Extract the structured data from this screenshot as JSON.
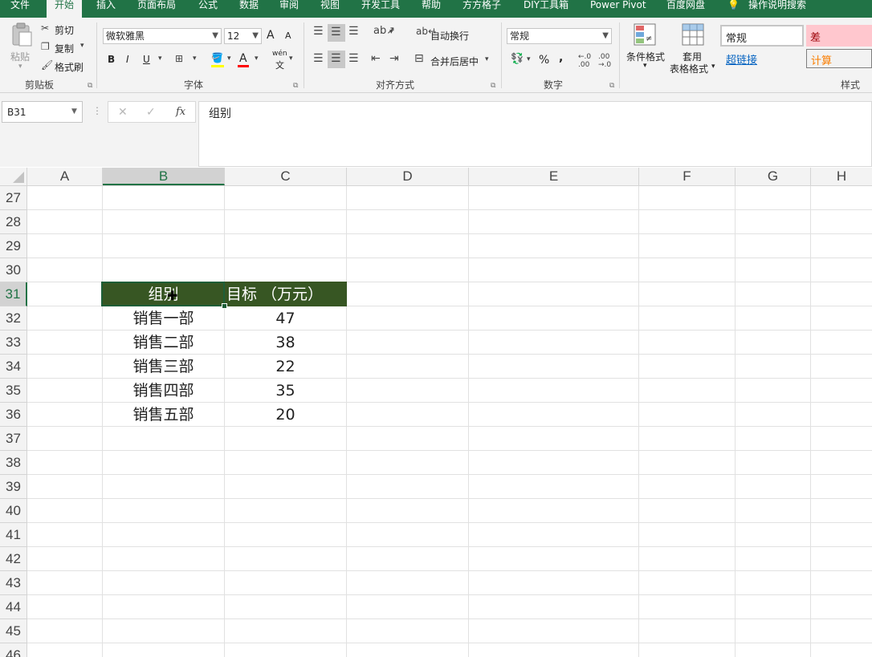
{
  "menu": {
    "tabs": [
      "文件",
      "开始",
      "插入",
      "页面布局",
      "公式",
      "数据",
      "审阅",
      "视图",
      "开发工具",
      "帮助",
      "方方格子",
      "DIY工具箱",
      "Power Pivot",
      "百度网盘"
    ],
    "tell_me": "操作说明搜索"
  },
  "ribbon": {
    "clipboard": {
      "paste": "粘贴",
      "cut": "剪切",
      "copy": "复制",
      "format_painter": "格式刷",
      "label": "剪贴板"
    },
    "font": {
      "name": "微软雅黑",
      "size": "12",
      "label": "字体",
      "bold": "B",
      "italic": "I",
      "underline": "U",
      "grow": "A",
      "shrink": "A",
      "phonetic": "wén",
      "phonetic_char": "文"
    },
    "alignment": {
      "wrap": "自动换行",
      "merge": "合并后居中",
      "label": "对齐方式"
    },
    "number": {
      "format": "常规",
      "label": "数字",
      "percent": "%",
      "comma": ","
    },
    "styles": {
      "cond_format": "条件格式",
      "table_format_1": "套用",
      "table_format_2": "表格格式",
      "normal": "常规",
      "bad": "差",
      "hyperlink": "超链接",
      "calc": "计算",
      "label": "样式"
    }
  },
  "formula_bar": {
    "name_box": "B31",
    "content": "组别",
    "fx": "fx",
    "cancel": "✕",
    "enter": "✓"
  },
  "sheet": {
    "columns": [
      "A",
      "B",
      "C",
      "D",
      "E",
      "F",
      "G",
      "H"
    ],
    "selected_column": "B",
    "rows": [
      "27",
      "28",
      "29",
      "30",
      "31",
      "32",
      "33",
      "34",
      "35",
      "36",
      "37",
      "38",
      "39",
      "40",
      "41",
      "42",
      "43",
      "44",
      "45",
      "46"
    ],
    "selected_row": "31",
    "header_color": "#375623",
    "table_header": [
      "组别",
      "目标 （万元）"
    ],
    "table_rows": [
      [
        "销售一部",
        "47"
      ],
      [
        "销售二部",
        "38"
      ],
      [
        "销售三部",
        "22"
      ],
      [
        "销售四部",
        "35"
      ],
      [
        "销售五部",
        "20"
      ]
    ]
  }
}
